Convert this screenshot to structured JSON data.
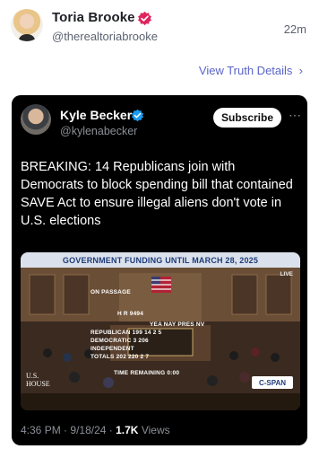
{
  "post": {
    "display_name": "Toria Brooke",
    "handle": "@therealtoriabrooke",
    "time_ago": "22m",
    "view_details": "View Truth Details",
    "verified_color": "#e0245e"
  },
  "embed": {
    "display_name": "Kyle Becker",
    "handle": "@kylenabecker",
    "subscribe_label": "Subscribe",
    "more_icon": "more-horizontal-icon",
    "text": "BREAKING: 14 Republicans join with Democrats to block spending bill that contained SAVE Act to ensure illegal aliens don't vote in U.S. elections",
    "verified_color": "#1d9bf0",
    "meta": {
      "time": "4:36 PM",
      "date": "9/18/24",
      "views_count": "1.7K",
      "views_label": "Views"
    }
  },
  "media": {
    "banner": "GOVERNMENT FUNDING UNTIL MARCH 28, 2025",
    "live": "LIVE",
    "on_passage": "ON PASSAGE",
    "bill": "H R 9494",
    "col_headers": "YEA NAY PRES NV",
    "row_republican": "REPUBLICAN 199 14 2 5",
    "row_democratic": "DEMOCRATIC 3 206",
    "row_independent": "INDEPENDENT",
    "row_totals": "TOTALS 202 220 2 7",
    "time_remaining": "TIME REMAINING 0:00",
    "logo_line1": "U.S.",
    "logo_line2": "HOUSE",
    "network": "C-SPAN"
  }
}
